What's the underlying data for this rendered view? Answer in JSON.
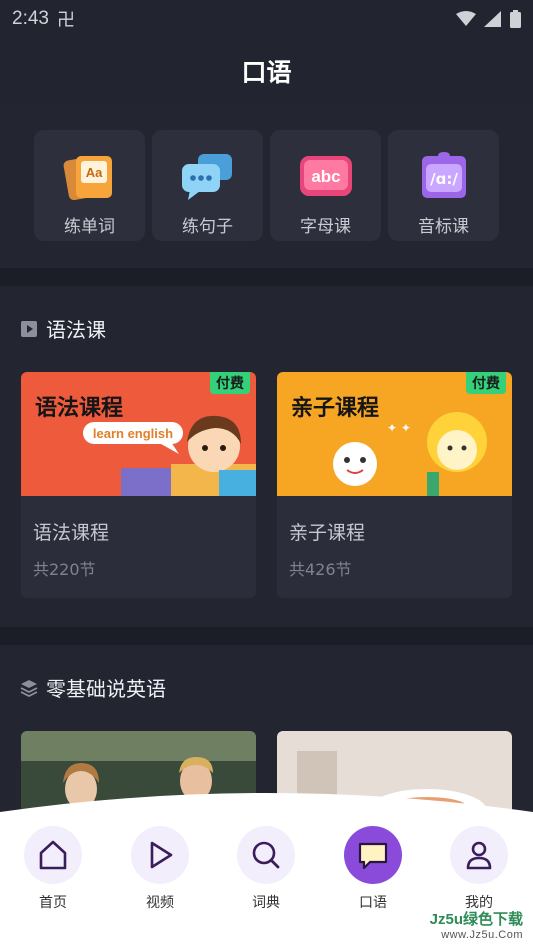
{
  "status_bar": {
    "time": "2:43",
    "extra": "卍"
  },
  "header": {
    "title": "口语"
  },
  "quick_tiles": [
    {
      "label": "练单词",
      "icon": "cards-aa-icon"
    },
    {
      "label": "练句子",
      "icon": "chat-bubbles-icon"
    },
    {
      "label": "字母课",
      "icon": "abc-icon"
    },
    {
      "label": "音标课",
      "icon": "phonetic-icon"
    }
  ],
  "grammar_section": {
    "title": "语法课",
    "cards": [
      {
        "banner_title": "语法课程",
        "bubble": "learn english",
        "badge": "付费",
        "title": "语法课程",
        "subtitle": "共220节"
      },
      {
        "banner_title": "亲子课程",
        "badge": "付费",
        "title": "亲子课程",
        "subtitle": "共426节"
      }
    ]
  },
  "basic_section": {
    "title": "零基础说英语"
  },
  "bottom_nav": [
    {
      "label": "首页",
      "icon": "home-icon",
      "active": false
    },
    {
      "label": "视频",
      "icon": "play-icon",
      "active": false
    },
    {
      "label": "词典",
      "icon": "search-icon",
      "active": false
    },
    {
      "label": "口语",
      "icon": "speech-bubble-icon",
      "active": true
    },
    {
      "label": "我的",
      "icon": "user-icon",
      "active": false
    }
  ],
  "watermark": {
    "main": "Jz5u绿色下载",
    "sub": "www.Jz5u.Com"
  },
  "colors": {
    "accent": "#8a4bdb",
    "paid_badge": "#33d17a",
    "background": "#1b1e27"
  }
}
